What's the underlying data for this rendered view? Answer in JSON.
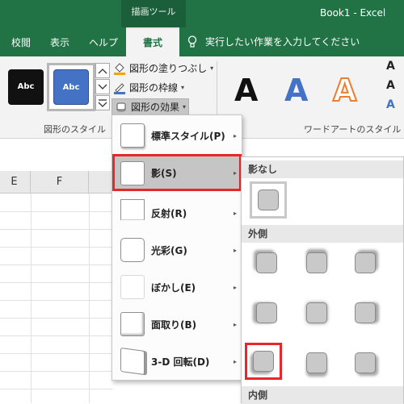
{
  "titlebar": {
    "context_tab": "描画ツール",
    "title": "Book1 - Excel"
  },
  "ribbon_tabs": [
    {
      "label": "校閲",
      "active": false
    },
    {
      "label": "表示",
      "active": false
    },
    {
      "label": "ヘルプ",
      "active": false
    },
    {
      "label": "書式",
      "active": true
    }
  ],
  "tell_me": "実行したい作業を入力してください",
  "shape_styles": {
    "swatch_black": "Abc",
    "swatch_blue": "Abc",
    "fill_label": "図形の塗りつぶし",
    "outline_label": "図形の枠線",
    "effects_label": "図形の効果",
    "group_label": "図形のスタイル"
  },
  "wordart": {
    "letters": [
      "A",
      "A",
      "A"
    ],
    "group_label": "ワードアートのスタイル"
  },
  "columns": [
    "E",
    "F"
  ],
  "effects_menu": {
    "items": [
      {
        "label": "標準スタイル(P)",
        "has_arrow": true
      },
      {
        "label": "影(S)",
        "has_arrow": true
      },
      {
        "label": "反射(R)",
        "has_arrow": true
      },
      {
        "label": "光彩(G)",
        "has_arrow": true
      },
      {
        "label": "ぼかし(E)",
        "has_arrow": true
      },
      {
        "label": "面取り(B)",
        "has_arrow": true
      },
      {
        "label": "3-D 回転(D)",
        "has_arrow": true
      }
    ]
  },
  "shadow_submenu": {
    "none_header": "影なし",
    "outer_header": "外側",
    "inner_header": "内側"
  },
  "colors": {
    "excel_green": "#217346",
    "highlight_red": "#e8262b",
    "swatch_blue": "#4472c4"
  }
}
